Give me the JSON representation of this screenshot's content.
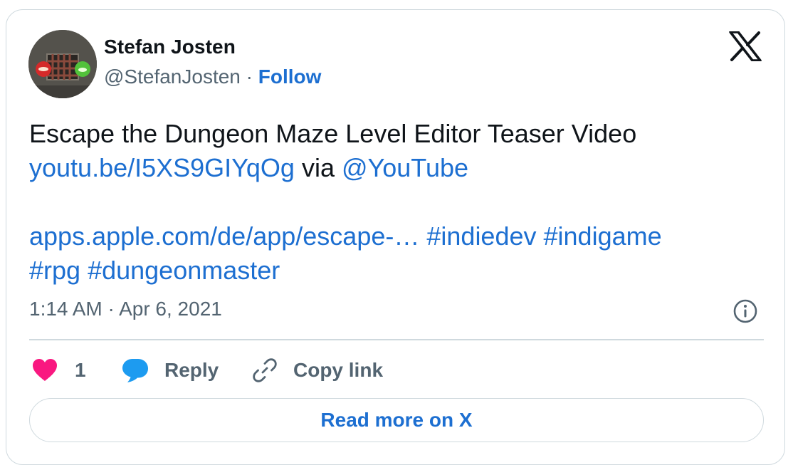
{
  "author": {
    "name": "Stefan Josten",
    "handle": "@StefanJosten",
    "separator": "·",
    "follow_label": "Follow"
  },
  "tweet": {
    "line1": "Escape the Dungeon Maze Level Editor Teaser Video",
    "link1": "youtu.be/I5XS9GIYqOg",
    "via": "via",
    "mention": "@YouTube",
    "link2": "apps.apple.com/de/app/escape-…",
    "hashtags": [
      "#indiedev",
      "#indigame",
      "#rpg",
      "#dungeonmaster"
    ]
  },
  "timestamp": {
    "time": "1:14 AM",
    "separator": "·",
    "date": "Apr 6, 2021"
  },
  "actions": {
    "like_count": "1",
    "reply_label": "Reply",
    "copy_label": "Copy link"
  },
  "read_more_label": "Read more on X",
  "colors": {
    "link": "#1d6fd1",
    "muted": "#536471",
    "heart": "#f91880",
    "reply_bubble": "#1d9bf0",
    "border": "#cfd9de"
  },
  "icons": [
    "x-logo-icon",
    "info-icon",
    "heart-icon",
    "reply-bubble-icon",
    "link-icon"
  ]
}
